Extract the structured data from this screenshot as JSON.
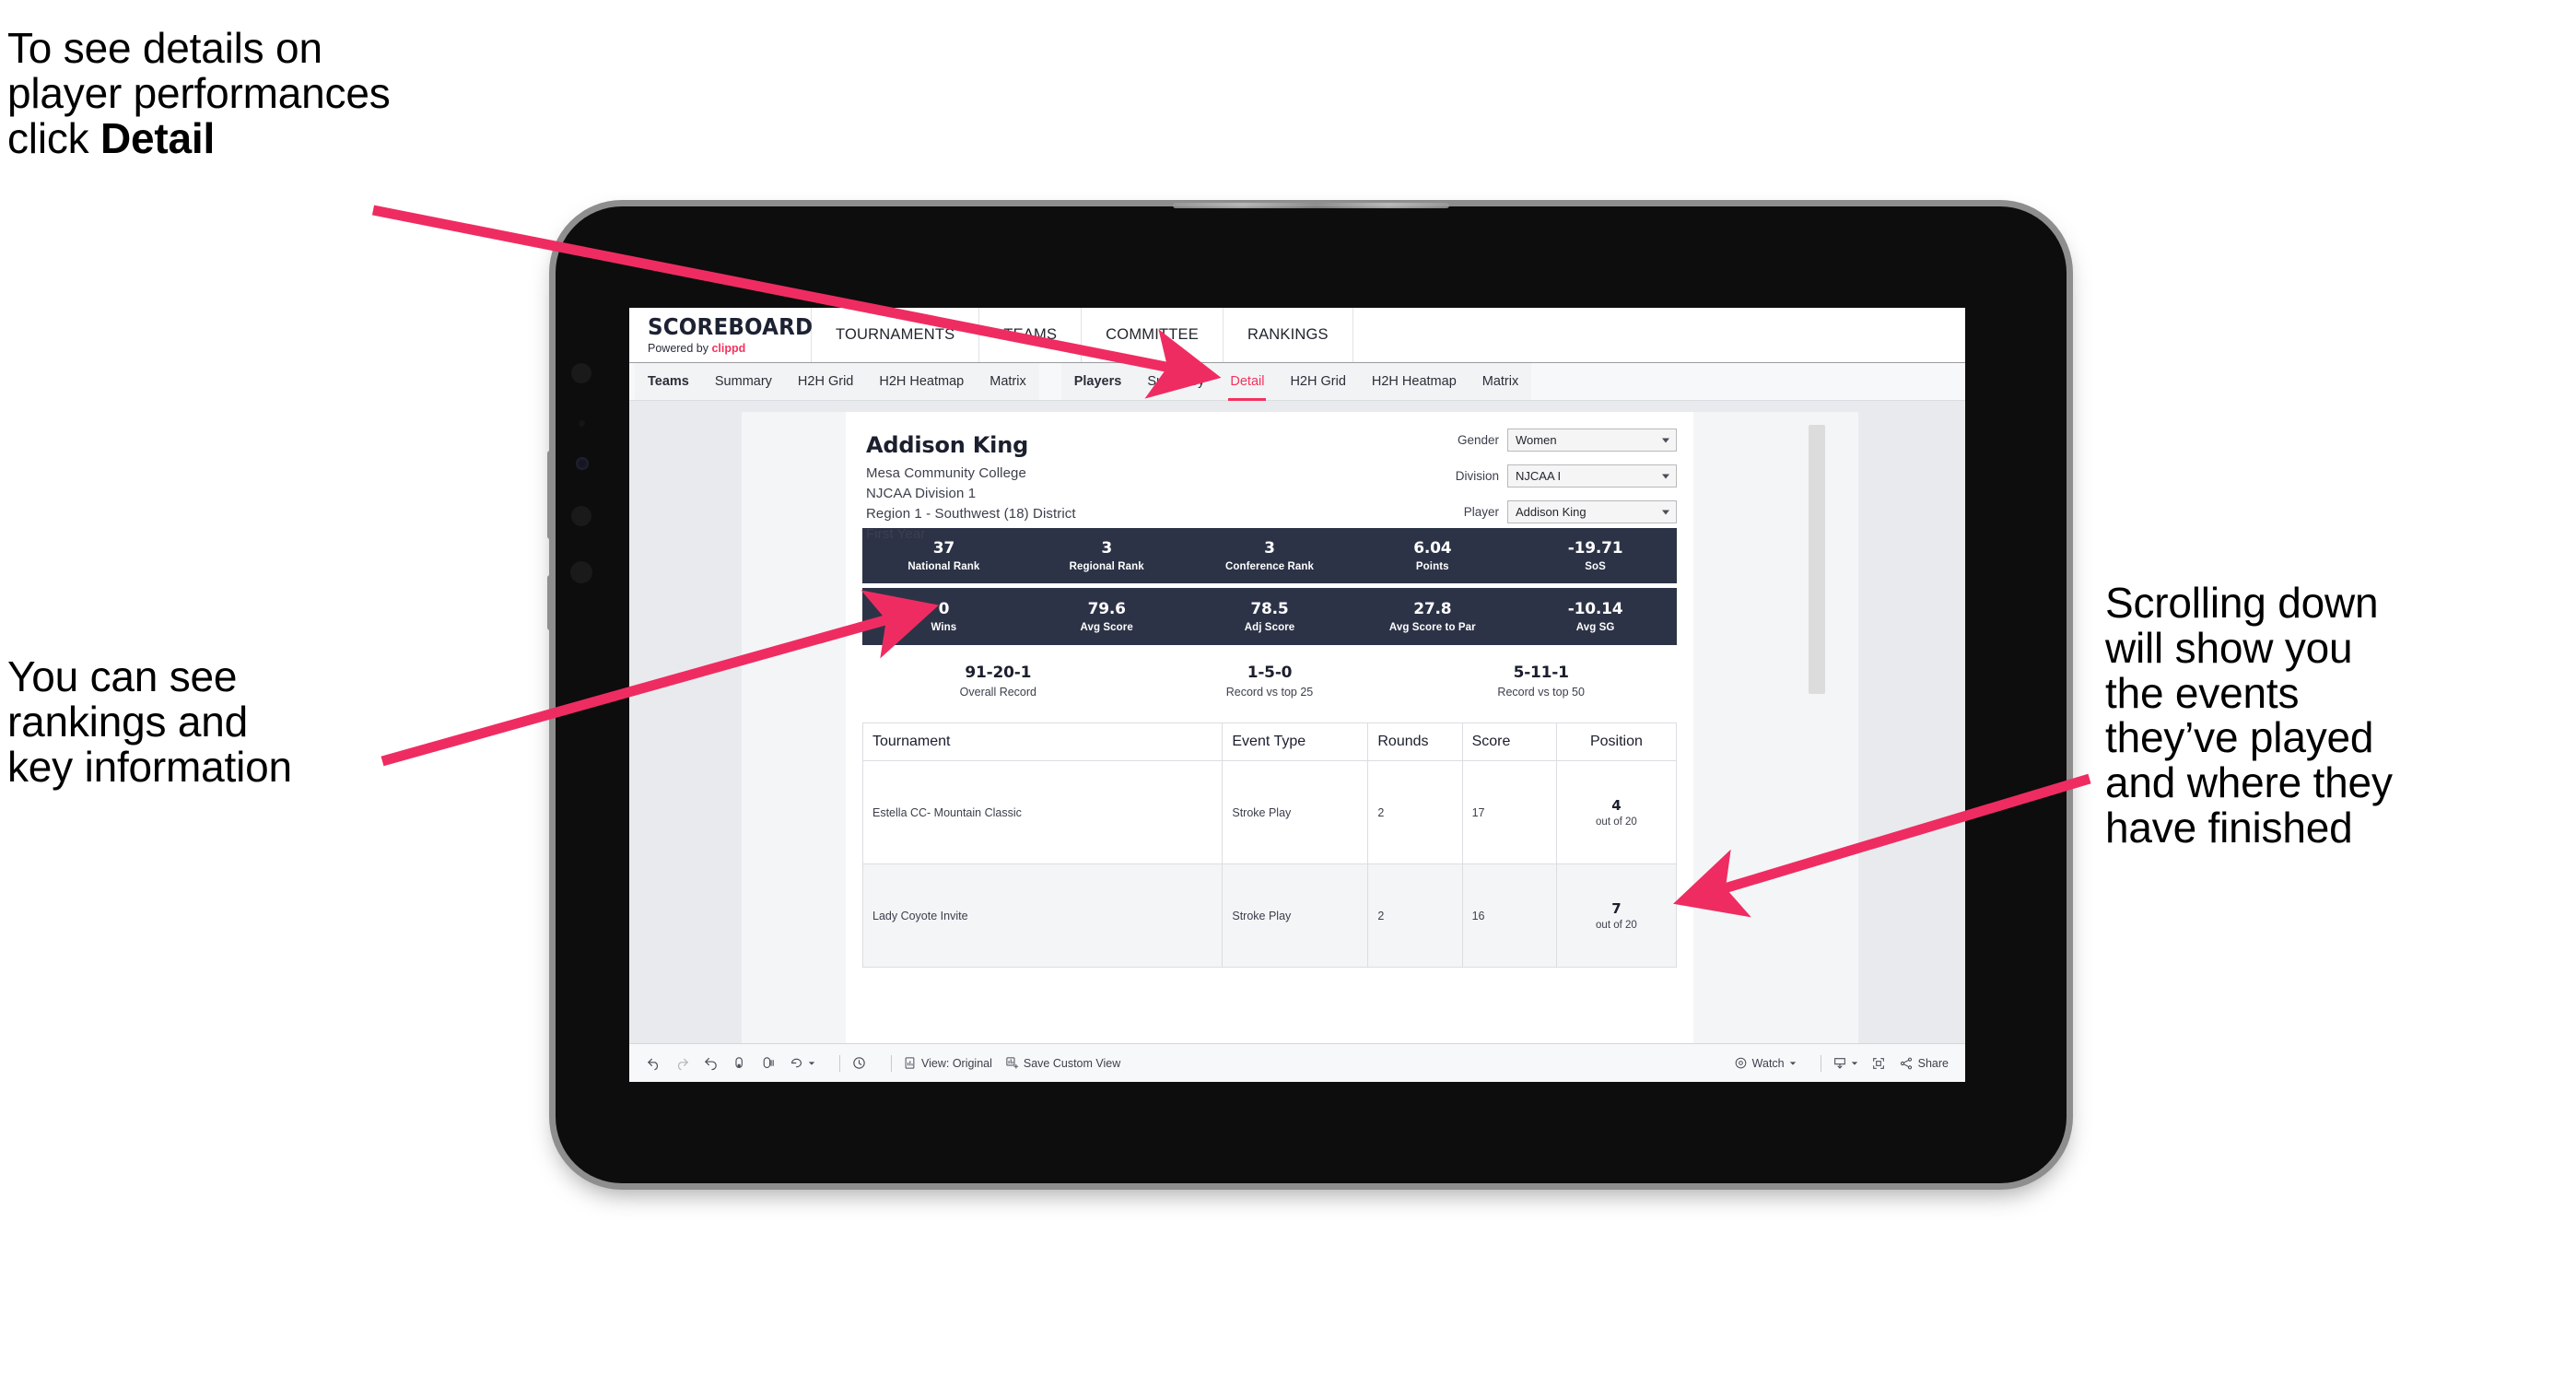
{
  "annotations": {
    "detail": "To see details on\nplayer performances\nclick ",
    "detail_bold": "Detail",
    "rankings": "You can see\nrankings and\nkey information",
    "scrolling": "Scrolling down\nwill show you\nthe events\nthey’ve played\nand where they\nhave finished"
  },
  "colors": {
    "accent_pink": "#f3335f",
    "stat_bar_navy": "#2d3347",
    "screen_bg": "#e9eaee"
  },
  "app": {
    "brand": {
      "title": "SCOREBOARD",
      "powered_prefix": "Powered by ",
      "powered_brand": "clippd"
    },
    "topnav": [
      "TOURNAMENTS",
      "TEAMS",
      "COMMITTEE",
      "RANKINGS"
    ],
    "tabs_teams": [
      "Teams",
      "Summary",
      "H2H Grid",
      "H2H Heatmap",
      "Matrix"
    ],
    "tabs_players": [
      "Players",
      "Summary",
      "Detail",
      "H2H Grid",
      "H2H Heatmap",
      "Matrix"
    ],
    "active_tab": "Detail"
  },
  "player": {
    "name": "Addison King",
    "school": "Mesa Community College",
    "division_line": "NJCAA Division 1",
    "region": "Region 1 - Southwest (18) District",
    "year": "First Year"
  },
  "filters": [
    {
      "label": "Gender",
      "value": "Women"
    },
    {
      "label": "Division",
      "value": "NJCAA I"
    },
    {
      "label": "Player",
      "value": "Addison King"
    }
  ],
  "stats_row1": [
    {
      "value": "37",
      "label": "National Rank"
    },
    {
      "value": "3",
      "label": "Regional Rank"
    },
    {
      "value": "3",
      "label": "Conference Rank"
    },
    {
      "value": "6.04",
      "label": "Points"
    },
    {
      "value": "-19.71",
      "label": "SoS"
    }
  ],
  "stats_row2": [
    {
      "value": "0",
      "label": "Wins"
    },
    {
      "value": "79.6",
      "label": "Avg Score"
    },
    {
      "value": "78.5",
      "label": "Adj Score"
    },
    {
      "value": "27.8",
      "label": "Avg Score to Par"
    },
    {
      "value": "-10.14",
      "label": "Avg SG"
    }
  ],
  "records": [
    {
      "value": "91-20-1",
      "label": "Overall Record"
    },
    {
      "value": "1-5-0",
      "label": "Record vs top 25"
    },
    {
      "value": "5-11-1",
      "label": "Record vs top 50"
    }
  ],
  "table": {
    "headers": [
      "Tournament",
      "Event Type",
      "Rounds",
      "Score",
      "Position"
    ],
    "rows": [
      {
        "tournament": "Estella CC- Mountain Classic",
        "event_type": "Stroke Play",
        "rounds": "2",
        "score": "17",
        "position": "4",
        "position_of": "out of 20"
      },
      {
        "tournament": "Lady Coyote Invite",
        "event_type": "Stroke Play",
        "rounds": "2",
        "score": "16",
        "position": "7",
        "position_of": "out of 20"
      }
    ]
  },
  "toolbar": {
    "view_label": "View: Original",
    "save_label": "Save Custom View",
    "watch_label": "Watch",
    "share_label": "Share"
  }
}
